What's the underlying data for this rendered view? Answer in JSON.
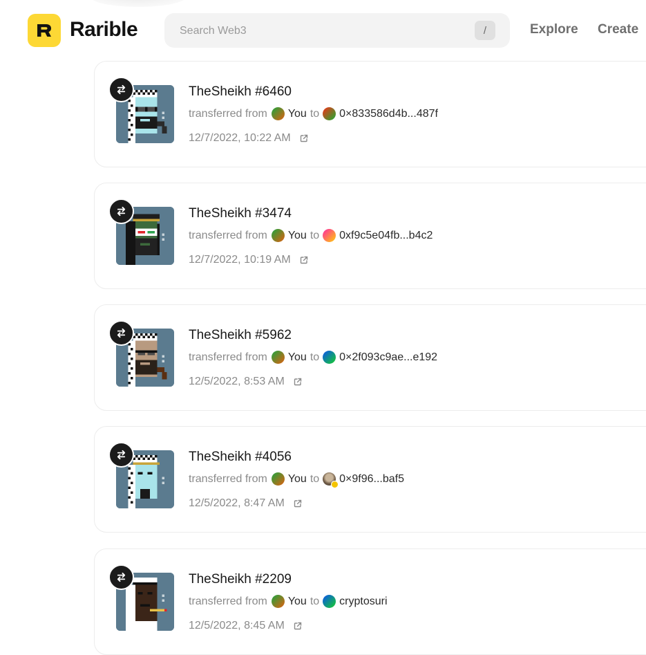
{
  "app": {
    "brand": "Rarible"
  },
  "search": {
    "placeholder": "Search Web3",
    "shortcut": "/"
  },
  "nav": {
    "explore": "Explore",
    "create": "Create"
  },
  "activity": [
    {
      "title": "TheSheikh #6460",
      "action": "transferred from",
      "from": "You",
      "connector": "to",
      "to": "0×833586d4b...487f",
      "to_avatar": "orange-green-gradient",
      "time": "12/7/2022, 10:22 AM"
    },
    {
      "title": "TheSheikh #3474",
      "action": "transferred from",
      "from": "You",
      "connector": "to",
      "to": "0xf9c5e04fb...b4c2",
      "to_avatar": "pink-yellow-gradient",
      "time": "12/7/2022, 10:19 AM"
    },
    {
      "title": "TheSheikh #5962",
      "action": "transferred from",
      "from": "You",
      "connector": "to",
      "to": "0×2f093c9ae...e192",
      "to_avatar": "blue-green-gradient",
      "time": "12/5/2022, 8:53 AM"
    },
    {
      "title": "TheSheikh #4056",
      "action": "transferred from",
      "from": "You",
      "connector": "to",
      "to": "0×9f96...baf5",
      "to_avatar": "photo-verified",
      "time": "12/5/2022, 8:47 AM"
    },
    {
      "title": "TheSheikh #2209",
      "action": "transferred from",
      "from": "You",
      "connector": "to",
      "to": "cryptosuri",
      "to_avatar": "blue-green-gradient",
      "time": "12/5/2022, 8:45 AM"
    }
  ],
  "icons": {
    "badge": "transfer-arrows-icon",
    "external": "external-link-icon"
  },
  "colors": {
    "brand_yellow": "#fdd835",
    "thumb_bg": "#5b7b8f"
  }
}
